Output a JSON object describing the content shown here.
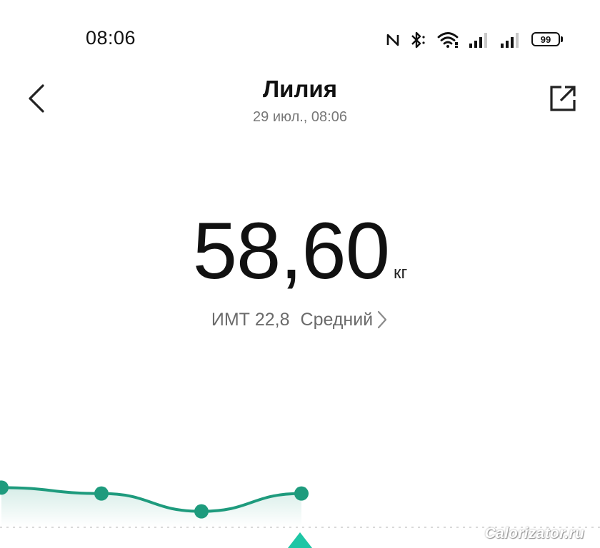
{
  "status_bar": {
    "time": "08:06",
    "battery_level": "99",
    "icons": [
      "nfc-icon",
      "bluetooth-icon",
      "wifi-icon",
      "signal-icon",
      "signal-icon",
      "battery-icon"
    ]
  },
  "header": {
    "title": "Лилия",
    "subtitle": "29 июл., 08:06",
    "back_icon": "chevron-left-icon",
    "share_icon": "share-icon"
  },
  "weight": {
    "value": "58,60",
    "unit": "кг"
  },
  "bmi": {
    "label": "ИМТ 22,8",
    "status": "Средний"
  },
  "chart_data": {
    "type": "line",
    "x": [
      1,
      2,
      3,
      4
    ],
    "series": [
      {
        "values": [
          58.7,
          58.6,
          58.3,
          58.6
        ]
      }
    ],
    "color": "#1e9b7d",
    "grid": false
  },
  "watermark": "Calorizator.ru"
}
